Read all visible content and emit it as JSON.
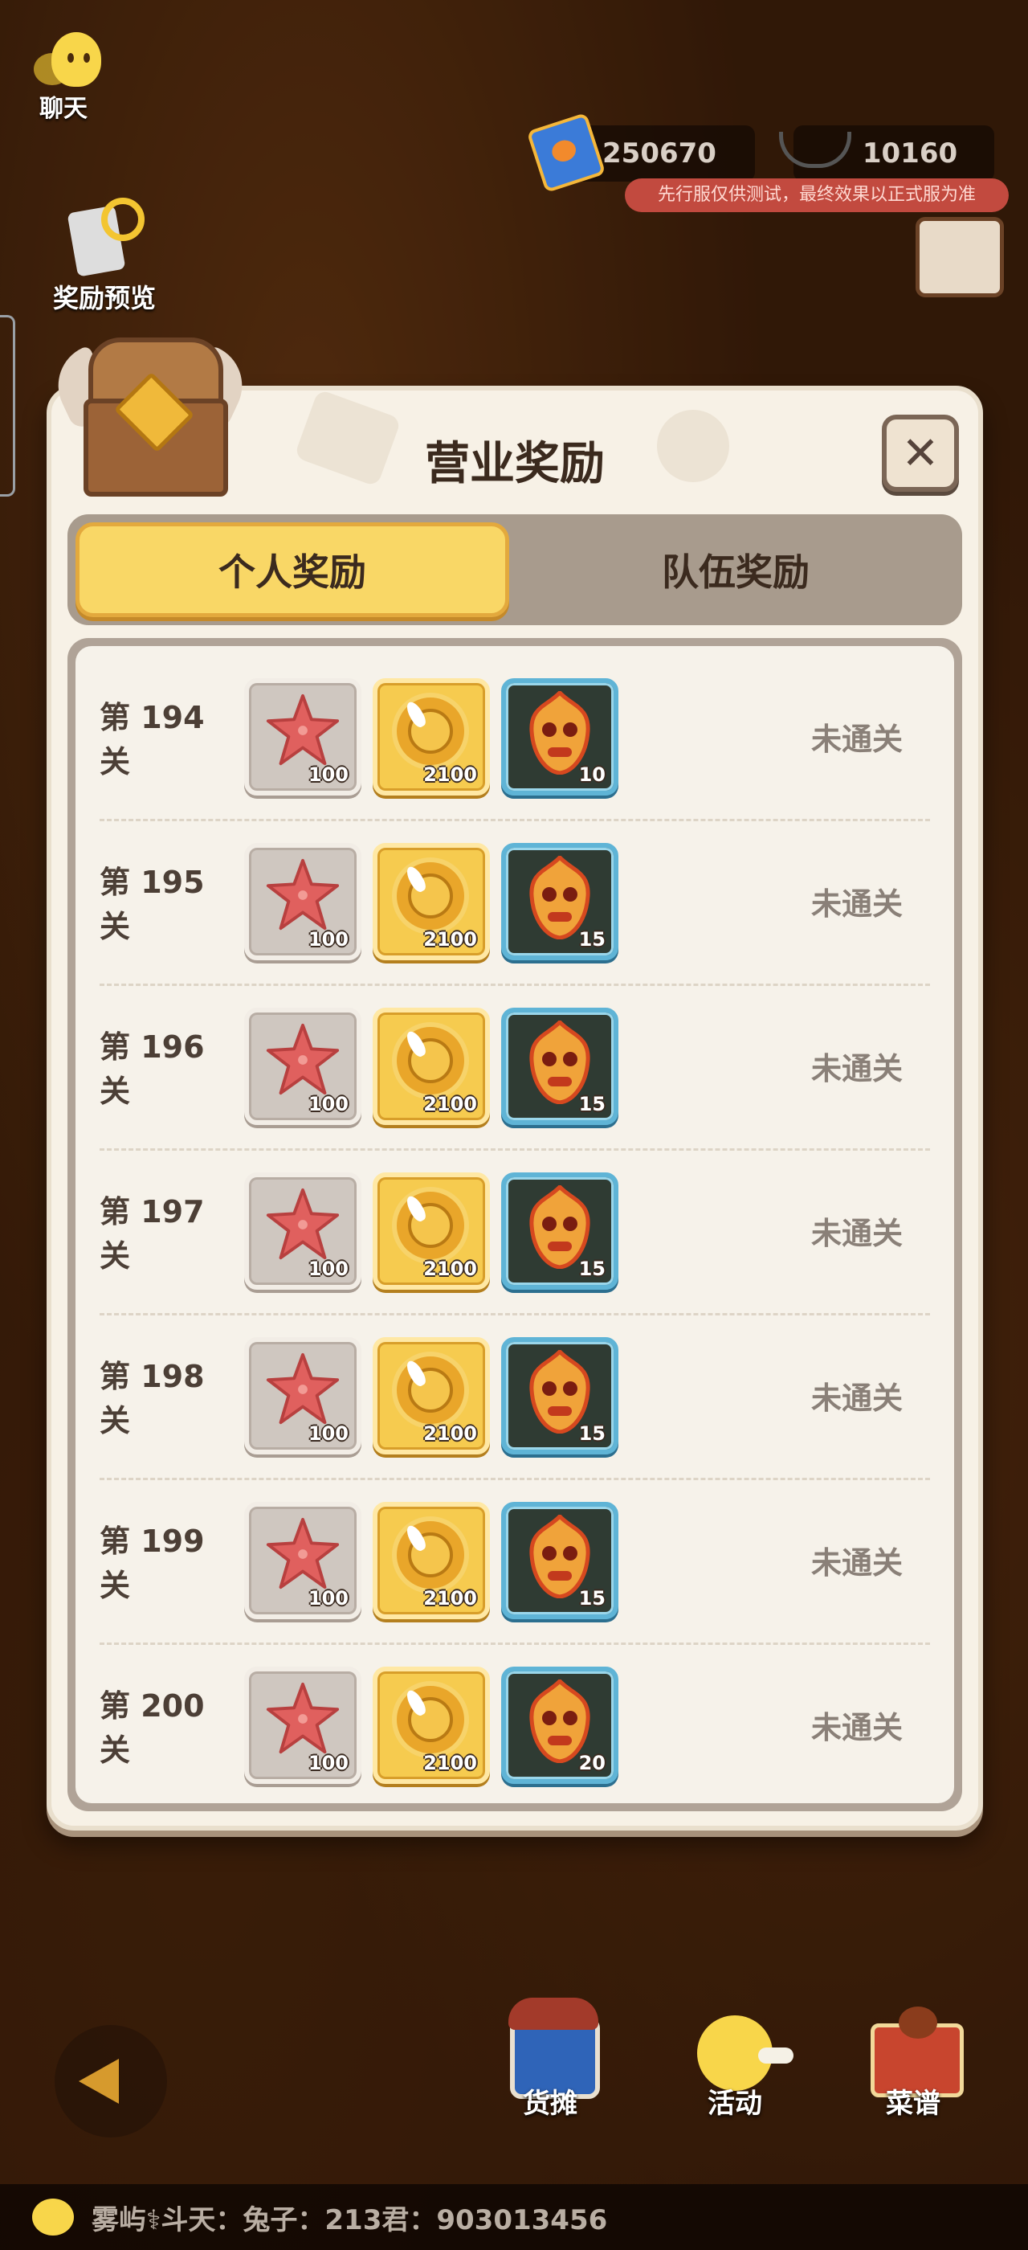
{
  "hud": {
    "chat_label": "聊天",
    "ticket_count": "250670",
    "pan_count": "10160",
    "notice": "先行服仅供测试，最终效果以正式服为准",
    "reward_preview_label": "奖励预览"
  },
  "dialog": {
    "title": "营业奖励",
    "close_symbol": "✕",
    "tabs": [
      {
        "label": "个人奖励",
        "active": true
      },
      {
        "label": "队伍奖励",
        "active": false
      }
    ],
    "rows": [
      {
        "level": "第 194 关",
        "rewards": [
          {
            "icon": "starfish-icon",
            "qty": "100"
          },
          {
            "icon": "coin-icon",
            "qty": "2100"
          },
          {
            "icon": "mask-icon",
            "qty": "10"
          }
        ],
        "status": "未通关"
      },
      {
        "level": "第 195 关",
        "rewards": [
          {
            "icon": "starfish-icon",
            "qty": "100"
          },
          {
            "icon": "coin-icon",
            "qty": "2100"
          },
          {
            "icon": "mask-icon",
            "qty": "15"
          }
        ],
        "status": "未通关"
      },
      {
        "level": "第 196 关",
        "rewards": [
          {
            "icon": "starfish-icon",
            "qty": "100"
          },
          {
            "icon": "coin-icon",
            "qty": "2100"
          },
          {
            "icon": "mask-icon",
            "qty": "15"
          }
        ],
        "status": "未通关"
      },
      {
        "level": "第 197 关",
        "rewards": [
          {
            "icon": "starfish-icon",
            "qty": "100"
          },
          {
            "icon": "coin-icon",
            "qty": "2100"
          },
          {
            "icon": "mask-icon",
            "qty": "15"
          }
        ],
        "status": "未通关"
      },
      {
        "level": "第 198 关",
        "rewards": [
          {
            "icon": "starfish-icon",
            "qty": "100"
          },
          {
            "icon": "coin-icon",
            "qty": "2100"
          },
          {
            "icon": "mask-icon",
            "qty": "15"
          }
        ],
        "status": "未通关"
      },
      {
        "level": "第 199 关",
        "rewards": [
          {
            "icon": "starfish-icon",
            "qty": "100"
          },
          {
            "icon": "coin-icon",
            "qty": "2100"
          },
          {
            "icon": "mask-icon",
            "qty": "15"
          }
        ],
        "status": "未通关"
      },
      {
        "level": "第 200 关",
        "rewards": [
          {
            "icon": "starfish-icon",
            "qty": "100"
          },
          {
            "icon": "coin-icon",
            "qty": "2100"
          },
          {
            "icon": "mask-icon",
            "qty": "20"
          }
        ],
        "status": "未通关"
      }
    ]
  },
  "bottom_nav": [
    {
      "label": "货摊",
      "icon": "stall-icon"
    },
    {
      "label": "活动",
      "icon": "duck-icon"
    },
    {
      "label": "菜谱",
      "icon": "recipe-book-icon"
    }
  ],
  "ticker": {
    "text": "雾屿⚕斗天：兔子：213君：903013456"
  },
  "colors": {
    "tab_active": "#f9d766",
    "panel": "#f7f1e6",
    "status_text": "#8a8078"
  }
}
